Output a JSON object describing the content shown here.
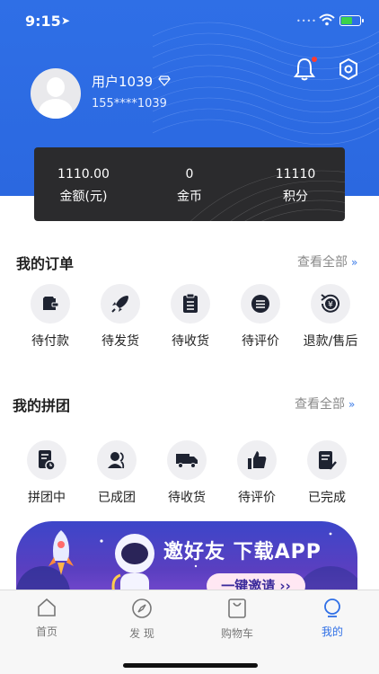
{
  "status_bar": {
    "time": "9:15",
    "location_arrow": "➤",
    "signal_dots": "••••"
  },
  "profile": {
    "name": "用户1039",
    "phone": "155****1039"
  },
  "wallet": {
    "items": [
      {
        "value": "1110.00",
        "label": "金额(元)"
      },
      {
        "value": "0",
        "label": "金币"
      },
      {
        "value": "11110",
        "label": "积分"
      }
    ]
  },
  "orders": {
    "title": "我的订单",
    "see_all": "查看全部",
    "chevron": "»",
    "items": [
      {
        "label": "待付款",
        "icon": "wallet-icon"
      },
      {
        "label": "待发货",
        "icon": "rocket-icon"
      },
      {
        "label": "待收货",
        "icon": "clipboard-icon"
      },
      {
        "label": "待评价",
        "icon": "chat-icon"
      },
      {
        "label": "退款/售后",
        "icon": "refund-icon"
      }
    ]
  },
  "group": {
    "title": "我的拼团",
    "see_all": "查看全部",
    "chevron": "»",
    "items": [
      {
        "label": "拼团中",
        "icon": "document-clock-icon"
      },
      {
        "label": "已成团",
        "icon": "users-icon"
      },
      {
        "label": "待收货",
        "icon": "truck-icon"
      },
      {
        "label": "待评价",
        "icon": "thumbs-up-icon"
      },
      {
        "label": "已完成",
        "icon": "document-check-icon"
      }
    ]
  },
  "banner": {
    "title": "邀好友 下载APP",
    "button": "一键邀请 ››"
  },
  "tabbar": {
    "items": [
      {
        "label": "首页",
        "icon": "home-icon"
      },
      {
        "label": "发 现",
        "icon": "compass-icon"
      },
      {
        "label": "购物车",
        "icon": "cart-icon"
      },
      {
        "label": "我的",
        "icon": "profile-icon",
        "active": true
      }
    ]
  },
  "colors": {
    "brand_blue": "#2f6fe6",
    "wallet_bg": "#2b2b2d",
    "badge_red": "#ff3b30",
    "battery_green": "#3cd24a"
  }
}
